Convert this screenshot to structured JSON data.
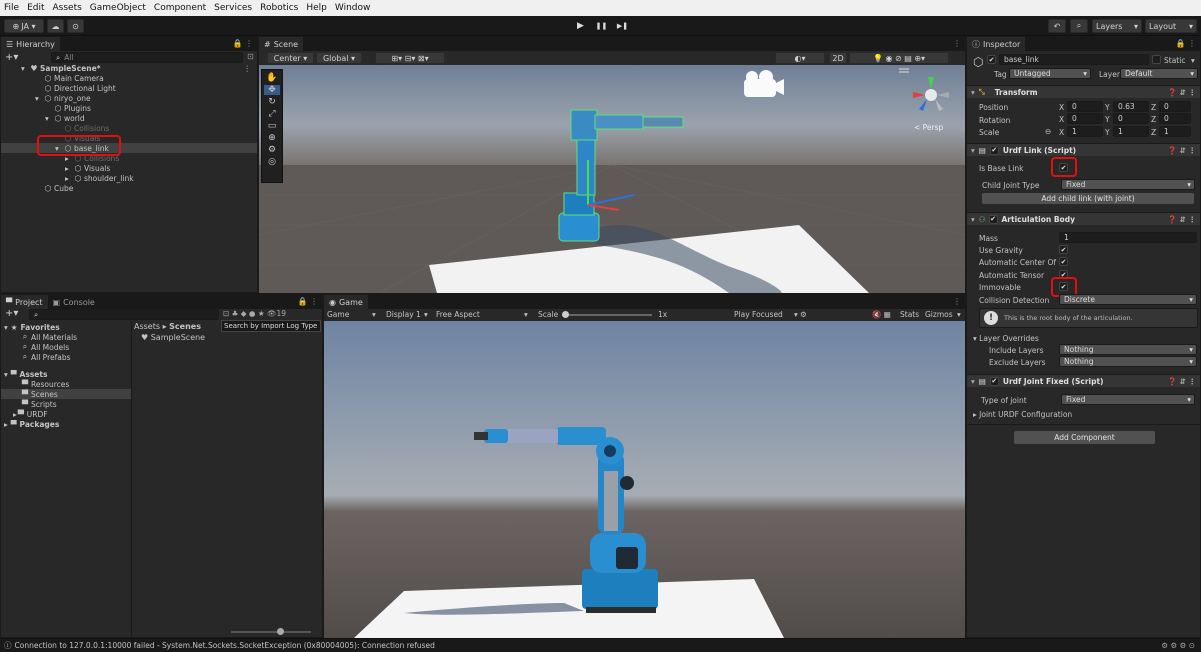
{
  "menu": [
    "File",
    "Edit",
    "Assets",
    "GameObject",
    "Component",
    "Services",
    "Robotics",
    "Help",
    "Window"
  ],
  "toolbar": {
    "account": "JA ▾",
    "play": "▶",
    "pause": "❚❚",
    "step": "▶❚",
    "layers": "Layers",
    "layout": "Layout"
  },
  "hierarchy": {
    "tab": "Hierarchy",
    "search_placeholder": "All",
    "items": [
      {
        "label": "SampleScene*",
        "depth": 0
      },
      {
        "label": "Main Camera",
        "depth": 1
      },
      {
        "label": "Directional Light",
        "depth": 1
      },
      {
        "label": "niryo_one",
        "depth": 1
      },
      {
        "label": "Plugins",
        "depth": 2
      },
      {
        "label": "world",
        "depth": 2
      },
      {
        "label": "Collisions",
        "depth": 3
      },
      {
        "label": "Visuals",
        "depth": 3
      },
      {
        "label": "base_link",
        "depth": 3
      },
      {
        "label": "Collisions",
        "depth": 4
      },
      {
        "label": "Visuals",
        "depth": 4
      },
      {
        "label": "shoulder_link",
        "depth": 4
      },
      {
        "label": "Cube",
        "depth": 1
      }
    ]
  },
  "scene": {
    "tab": "Scene",
    "pivot": "Center ▾",
    "space": "Global ▾",
    "mode2d": "2D",
    "persp": "< Persp"
  },
  "project": {
    "tab": "Project",
    "console_tab": "Console",
    "count": "19",
    "breadcrumb_root": "Assets",
    "breadcrumb_leaf": "Scenes",
    "tooltip": "Search by Import Log Type",
    "favorites_label": "Favorites",
    "favorites": [
      "All Materials",
      "All Models",
      "All Prefabs"
    ],
    "assets_label": "Assets",
    "assets": [
      "Resources",
      "Scenes",
      "Scripts",
      "URDF"
    ],
    "packages_label": "Packages",
    "files": [
      "SampleScene"
    ]
  },
  "game": {
    "tab": "Game",
    "mode": "Game",
    "display": "Display 1",
    "aspect": "Free Aspect",
    "scale_label": "Scale",
    "scale_value": "1x",
    "play_focused": "Play Focused",
    "stats": "Stats",
    "gizmos": "Gizmos"
  },
  "inspector": {
    "tab": "Inspector",
    "object_name": "base_link",
    "static_label": "Static",
    "tag_label": "Tag",
    "tag_value": "Untagged",
    "layer_label": "Layer",
    "layer_value": "Default",
    "transform": {
      "title": "Transform",
      "position_label": "Position",
      "pos": [
        "0",
        "0.63",
        "0"
      ],
      "rotation_label": "Rotation",
      "rot": [
        "0",
        "0",
        "0"
      ],
      "scale_label": "Scale",
      "scale": [
        "1",
        "1",
        "1"
      ]
    },
    "urdf_link": {
      "title": "Urdf Link (Script)",
      "is_base_label": "Is Base Link",
      "child_joint_label": "Child Joint Type",
      "child_joint_value": "Fixed",
      "add_child_button": "Add child link (with joint)"
    },
    "articulation": {
      "title": "Articulation Body",
      "mass_label": "Mass",
      "mass_value": "1",
      "use_gravity": "Use Gravity",
      "auto_com": "Automatic Center Of M",
      "auto_tensor": "Automatic Tensor",
      "immovable": "Immovable",
      "collision_label": "Collision Detection",
      "collision_value": "Discrete",
      "info": "This is the root body of the articulation.",
      "layer_overrides": "Layer Overrides",
      "include_label": "Include Layers",
      "include_value": "Nothing",
      "exclude_label": "Exclude Layers",
      "exclude_value": "Nothing"
    },
    "joint_fixed": {
      "title": "Urdf Joint Fixed (Script)",
      "type_label": "Type of joint",
      "type_value": "Fixed",
      "config_label": "Joint URDF Configuration"
    },
    "add_component": "Add Component"
  },
  "status": "Connection to 127.0.0.1:10000 failed - System.Net.Sockets.SocketException (0x80004005): Connection refused",
  "colors": {
    "robot": "#1e7fbf",
    "highlight": "#e01010",
    "accent": "#2f6fd6"
  }
}
